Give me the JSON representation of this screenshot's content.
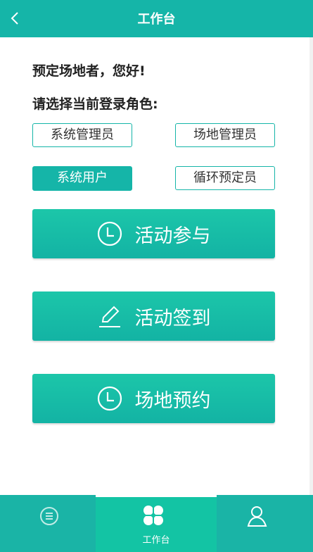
{
  "header": {
    "title": "工作台",
    "back_icon": "chevron-left-icon"
  },
  "greeting": "预定场地者，您好!",
  "prompt": "请选择当前登录角色:",
  "roles": [
    {
      "label": "系统管理员",
      "selected": false
    },
    {
      "label": "场地管理员",
      "selected": false
    },
    {
      "label": "系统用户",
      "selected": true
    },
    {
      "label": "循环预定员",
      "selected": false
    }
  ],
  "actions": [
    {
      "label": "活动参与",
      "icon": "clock-icon"
    },
    {
      "label": "活动签到",
      "icon": "pencil-icon"
    },
    {
      "label": "场地预约",
      "icon": "clock-icon"
    }
  ],
  "bottom_nav": {
    "items": [
      {
        "icon": "list-icon",
        "label": ""
      },
      {
        "icon": "grid-clover-icon",
        "label": "工作台",
        "active": true
      },
      {
        "icon": "user-icon",
        "label": ""
      }
    ]
  },
  "colors": {
    "primary": "#15b5a8",
    "gradient_top": "#1cc6a9"
  }
}
